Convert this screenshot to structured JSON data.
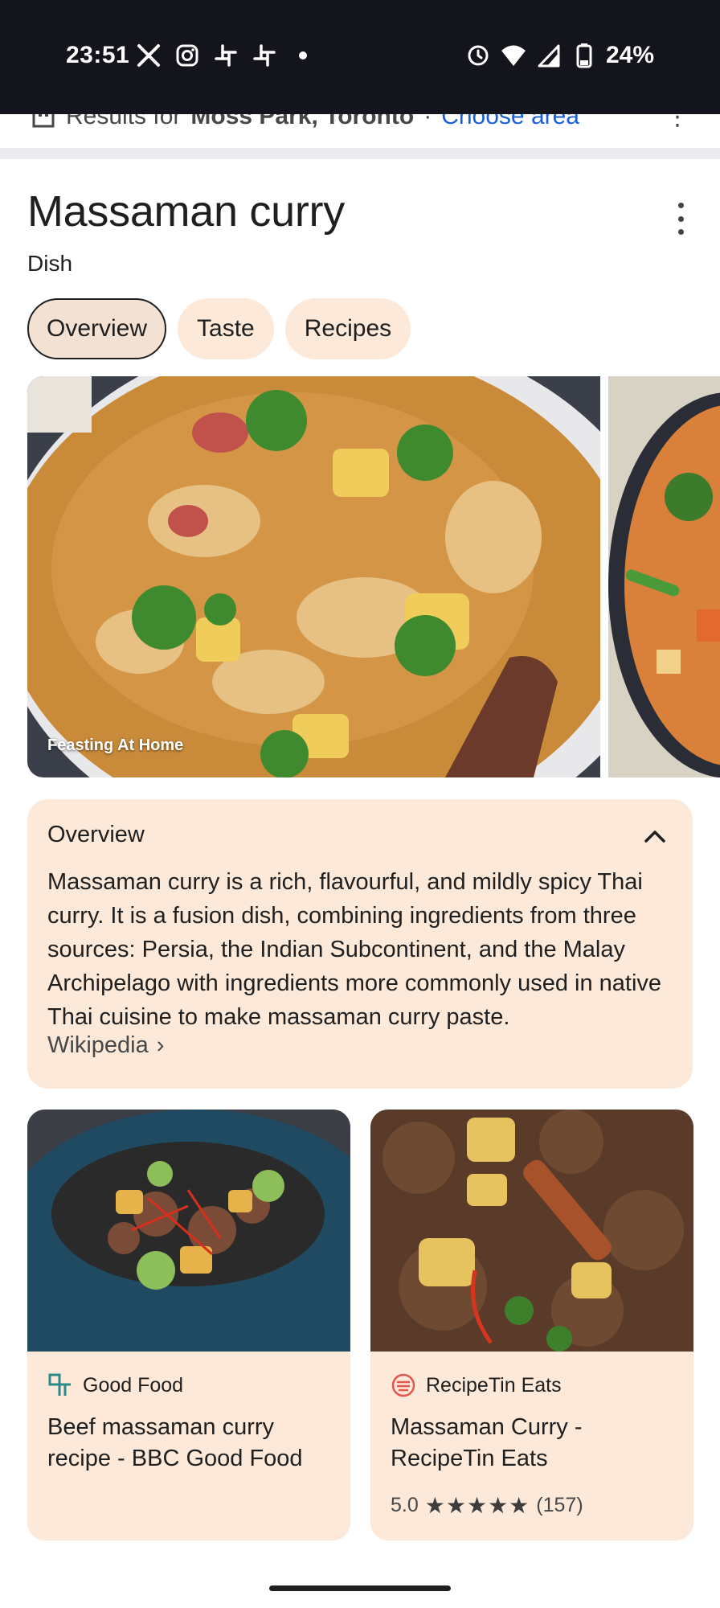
{
  "status_bar": {
    "time": "23:51",
    "left_icons": [
      "x-icon",
      "instagram-icon",
      "slack-icon",
      "slack-icon",
      "dot-icon"
    ],
    "right_icons": [
      "alarm-icon",
      "wifi-icon",
      "signal-icon",
      "battery-icon"
    ],
    "battery": "24%"
  },
  "location": {
    "prefix": "Results for",
    "place": "Moss Park, Toronto",
    "separator": "·",
    "link": "Choose area"
  },
  "entity": {
    "title": "Massaman curry",
    "subtitle": "Dish"
  },
  "chips": [
    {
      "label": "Overview",
      "active": true
    },
    {
      "label": "Taste",
      "active": false
    },
    {
      "label": "Recipes",
      "active": false
    }
  ],
  "carousel": {
    "main_credit": "Feasting At Home"
  },
  "overview": {
    "title": "Overview",
    "body": "Massaman curry is a rich, flavourful, and mildly spicy Thai curry. It is a fusion dish, combining ingredients from three sources: Persia, the Indian Subcontinent, and the Malay Archipelago with ingredients more commonly used in native Thai cuisine to make massaman curry paste.",
    "source": "Wikipedia",
    "source_chevron": "›"
  },
  "recipes": [
    {
      "source": "Good Food",
      "title": "Beef massaman curry recipe - BBC Good Food",
      "rating": null
    },
    {
      "source": "RecipeTin Eats",
      "title": "Massaman Curry - RecipeTin Eats",
      "rating": "5.0",
      "stars": "★★★★★",
      "reviews": "(157)"
    }
  ],
  "colors": {
    "status_bar_bg": "#13141c",
    "card_bg": "#fde9d9",
    "link_blue": "#1a5fd6",
    "text_primary": "#1f1f1f"
  }
}
